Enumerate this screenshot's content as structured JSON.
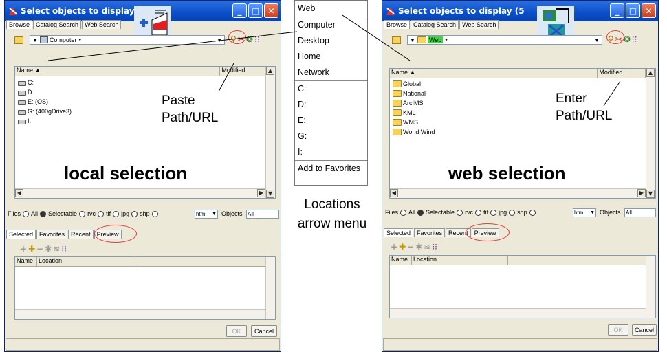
{
  "left_window": {
    "title": "Select objects to display (",
    "tabs": [
      "Browse",
      "Catalog Search",
      "Web Search"
    ],
    "location": "Computer",
    "columns": [
      "Name ▲",
      "Modified"
    ],
    "items": [
      "C:",
      "D:",
      "E: (OS)",
      "G: (400gDrive3)",
      "I:"
    ],
    "overlay_big": "local selection",
    "annotation": [
      "Paste",
      "Path/URL"
    ]
  },
  "right_window": {
    "title": "Select objects to display (5",
    "tabs": [
      "Browse",
      "Catalog Search",
      "Web Search"
    ],
    "location": "Web",
    "columns": [
      "Name ▲",
      "Modified"
    ],
    "items": [
      "Global",
      "National",
      "ArcIMS",
      "KML",
      "WMS",
      "World Wind"
    ],
    "overlay_big": "web selection",
    "annotation": [
      "Enter",
      "Path/URL"
    ]
  },
  "files_row": {
    "label": "Files",
    "options": [
      "All",
      "Selectable",
      "rvc",
      "tif",
      "jpg",
      "shp"
    ],
    "ext_value": "htm",
    "objects_label": "Objects",
    "objects_value": "All"
  },
  "bottom_tabs": [
    "Selected",
    "Favorites",
    "Recent",
    "Preview"
  ],
  "bottom_columns": [
    "Name",
    "Location"
  ],
  "buttons": {
    "ok": "OK",
    "cancel": "Cancel"
  },
  "title_buttons": {
    "minimize": "_",
    "maximize": "□",
    "close": "✕"
  },
  "dropdown_arrow": "▼",
  "menu": {
    "items_top": [
      "Web",
      "Computer",
      "Desktop",
      "Home",
      "Network"
    ],
    "items_drives": [
      "C:",
      "D:",
      "E:",
      "G:",
      "I:"
    ],
    "favorites": "Add to Favorites"
  },
  "caption": [
    "Locations",
    "arrow menu"
  ],
  "colors": {
    "titlebar": "#0a4fc8",
    "highlight": "#e23a3a",
    "web_highlight": "#3bd93b"
  }
}
